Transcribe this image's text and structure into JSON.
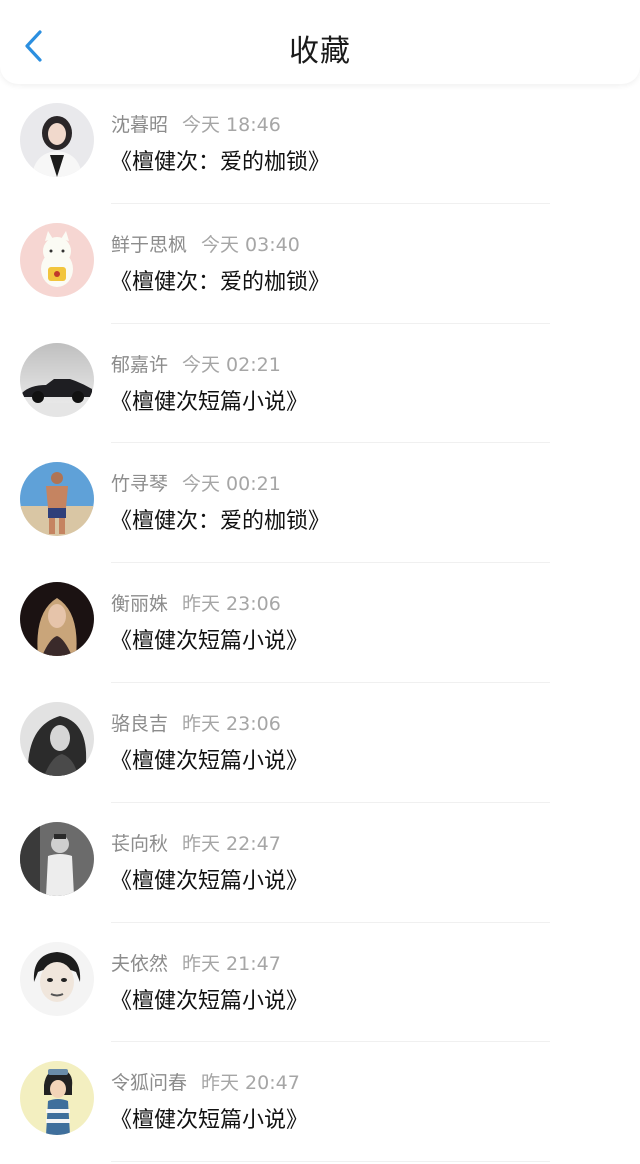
{
  "header": {
    "title": "收藏",
    "back_icon": "chevron-left-icon",
    "accent": "#2b8fe0"
  },
  "items": [
    {
      "name": "沈暮昭",
      "time": "今天 18:46",
      "book": "《檀健次：爱的枷锁》",
      "avatar_icon": "avatar-woman-white-jacket"
    },
    {
      "name": "鲜于思枫",
      "time": "今天 03:40",
      "book": "《檀健次：爱的枷锁》",
      "avatar_icon": "avatar-lucky-cat"
    },
    {
      "name": "郁嘉许",
      "time": "今天 02:21",
      "book": "《檀健次短篇小说》",
      "avatar_icon": "avatar-classic-car"
    },
    {
      "name": "竹寻琴",
      "time": "今天 00:21",
      "book": "《檀健次：爱的枷锁》",
      "avatar_icon": "avatar-man-beach"
    },
    {
      "name": "衡丽姝",
      "time": "昨天 23:06",
      "book": "《檀健次短篇小说》",
      "avatar_icon": "avatar-woman-blonde-dark"
    },
    {
      "name": "骆良吉",
      "time": "昨天 23:06",
      "book": "《檀健次短篇小说》",
      "avatar_icon": "avatar-woman-bw"
    },
    {
      "name": "苌向秋",
      "time": "昨天 22:47",
      "book": "《檀健次短篇小说》",
      "avatar_icon": "avatar-man-bw"
    },
    {
      "name": "夫依然",
      "time": "昨天 21:47",
      "book": "《檀健次短篇小说》",
      "avatar_icon": "avatar-woman-sketch"
    },
    {
      "name": "令狐问春",
      "time": "昨天 20:47",
      "book": "《檀健次短篇小说》",
      "avatar_icon": "avatar-girl-cartoon"
    }
  ]
}
